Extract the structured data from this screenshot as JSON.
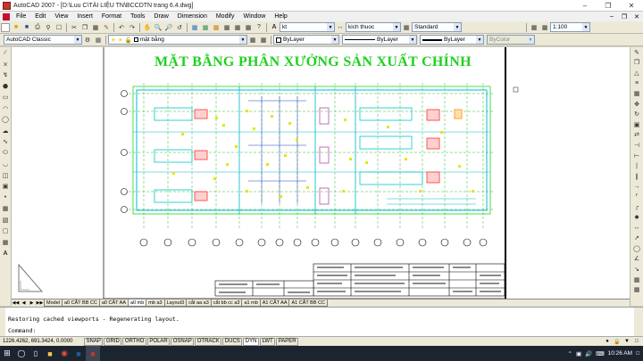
{
  "window": {
    "title": "AutoCAD 2007 - [D:\\Luu C\\TÀI LIỆU TN\\BCCDTN trang 6.4.dwg]"
  },
  "menu": [
    "File",
    "Edit",
    "View",
    "Insert",
    "Format",
    "Tools",
    "Draw",
    "Dimension",
    "Modify",
    "Window",
    "Help"
  ],
  "toolbar1": {
    "text_style": "kt",
    "dim_style": "kich thuoc",
    "table_style": "Standard",
    "scale": "1:100"
  },
  "toolbar2": {
    "workspace": "AutoCAD Classic",
    "layer": "mặt bằng",
    "color": "ByLayer",
    "linetype": "ByLayer",
    "lineweight": "ByLayer",
    "plotstyle": "ByColor"
  },
  "drawing": {
    "title": "MẶT BẰNG PHÂN XƯỞNG SẢN XUẤT CHÍNH"
  },
  "tabs": [
    "Model",
    "a0 CẮT BB CC",
    "a0 CẮT AA",
    "a0 mb",
    "mb a3",
    "Layout3",
    "cắt aa a3",
    "cắt bb cc a3",
    "a1 mb",
    "A1 CẮT AA",
    "A1 CẮT BB CC"
  ],
  "active_tab": "a0 mb",
  "command": {
    "history": "Restoring cached viewports - Regenerating layout.",
    "prompt": "Command:"
  },
  "status": {
    "coords": "1226.4262, 691.3424, 0.0000",
    "buttons": [
      "SNAP",
      "GRID",
      "ORTHO",
      "POLAR",
      "OSNAP",
      "OTRACK",
      "DUCS",
      "DYN",
      "LWT",
      "PAPER"
    ]
  },
  "taskbar": {
    "time": "10:26 AM"
  },
  "colors": {
    "drawing_title": "#1fd11f",
    "grid": "#00cc00",
    "walls": "#00bcd4",
    "taskbar": "#1c2430"
  }
}
